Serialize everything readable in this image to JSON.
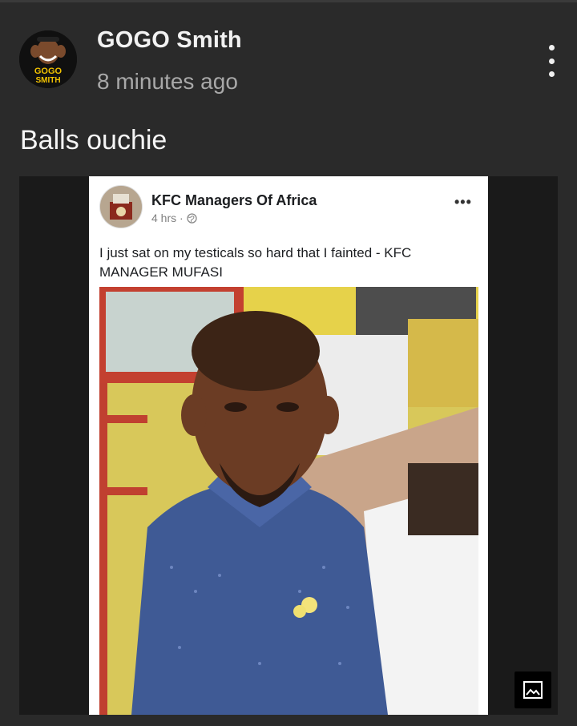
{
  "post": {
    "author_name": "GOGO Smith",
    "timestamp": "8 minutes ago",
    "caption": "Balls ouchie",
    "avatar_text_line1": "GOGO",
    "avatar_text_line2": "SMITH"
  },
  "embedded_post": {
    "page_name": "KFC Managers Of Africa",
    "time": "4 hrs · ",
    "audience_icon": "globe-icon",
    "text": "I just sat on my testicals so hard that I fainted - KFC MANAGER MUFASI",
    "more_label": "•••"
  },
  "icons": {
    "more": "more-vertical-icon",
    "gallery": "image-gallery-icon"
  },
  "colors": {
    "background": "#2a2a2a",
    "author_text": "#f2f2f2",
    "timestamp_text": "#a8a8a8"
  }
}
